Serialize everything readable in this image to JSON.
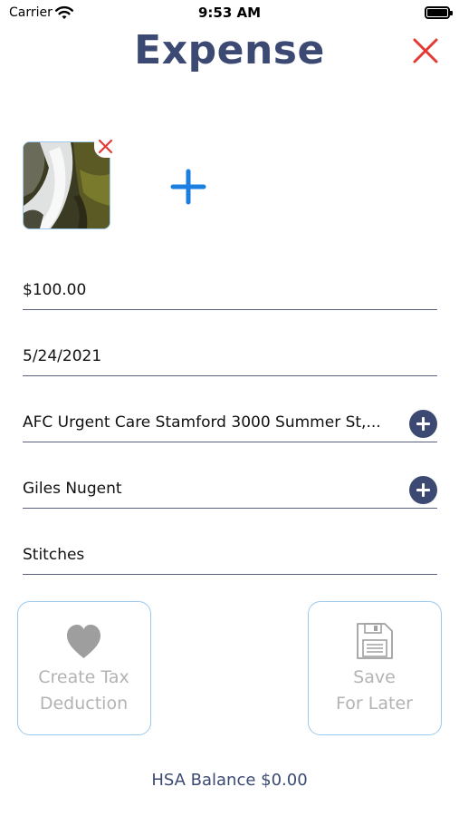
{
  "status_bar": {
    "carrier": "Carrier",
    "time": "9:53 AM",
    "icons": [
      "wifi-icon",
      "battery-icon"
    ]
  },
  "header": {
    "title": "Expense",
    "close_icon": "close-icon"
  },
  "attachments": {
    "items": [
      {
        "icon": "waterfall-photo-thumbnail",
        "remove_icon": "remove-icon"
      }
    ],
    "add_icon": "plus-icon"
  },
  "form": {
    "amount": "$100.00",
    "date": "5/24/2021",
    "provider": "AFC Urgent Care Stamford 3000 Summer St,...",
    "patient": "Giles Nugent",
    "description": "Stitches",
    "add_icon": "plus-circle-icon"
  },
  "actions": {
    "tax_deduction": {
      "line1": "Create Tax",
      "line2": "Deduction",
      "icon": "heart-icon"
    },
    "save_later": {
      "line1": "Save",
      "line2": "For Later",
      "icon": "save-document-icon"
    }
  },
  "footer": {
    "balance": "HSA Balance $0.00"
  },
  "colors": {
    "title": "#3c4a73",
    "close": "#e53935",
    "plus": "#1a7fe0",
    "card_border": "#9cc9ee",
    "disabled_text": "#b3b3b3",
    "field_underline": "#58607e"
  }
}
